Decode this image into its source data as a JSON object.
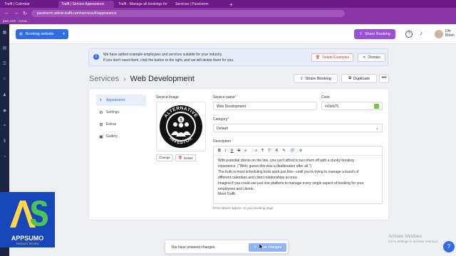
{
  "browser": {
    "tabs": [
      {
        "label": "Trafft | Calendar",
        "active": false
      },
      {
        "label": "Trafft | Service Appearance",
        "active": true
      },
      {
        "label": "Trafft - Manage all bookings for",
        "active": false
      },
      {
        "label": "Services | Passiverm",
        "active": false
      }
    ],
    "new_tab_glyph": "+",
    "url": "passiverm.admin.trafft.com/services/4/appearance",
    "bookmark_text": "pact.com - Actua..."
  },
  "header": {
    "business_button": "Booking website",
    "share_button": "Share Booking",
    "user_name_line1": "Dhr",
    "user_name_line2": "Boleh",
    "icons": [
      "help-icon",
      "bell-icon",
      "settings-icon"
    ]
  },
  "banner": {
    "line1": "We have added example employees and services suitable for your industry.",
    "line2": "If you don't need them, click the button to the right, and we will delete them for you.",
    "delete_examples": "Delete Examples",
    "dismiss": "Dismiss"
  },
  "breadcrumb": {
    "parent": "Services",
    "separator": "›",
    "current": "Web Development"
  },
  "page_actions": {
    "share": "Share Booking",
    "duplicate": "Duplicate",
    "more": "•••"
  },
  "subnav": [
    {
      "label": "Appearance",
      "icon": "palette-icon",
      "glyph": "◐",
      "active": true
    },
    {
      "label": "Settings",
      "icon": "gear-icon",
      "glyph": "⚙",
      "active": false
    },
    {
      "label": "Extras",
      "icon": "extras-icon",
      "glyph": "⊞",
      "active": false
    },
    {
      "label": "Gallery",
      "icon": "gallery-icon",
      "glyph": "▣",
      "active": false
    }
  ],
  "form": {
    "service_image_label": "Service Image",
    "logo_top_text": "ALTERNATIVE",
    "logo_bottom_text": "INVESTOR",
    "change_button": "Change",
    "delete_button": "Delete",
    "service_name_label": "Service name",
    "required_mark": "*",
    "service_name_value": "Web Development",
    "color_label": "Color",
    "color_value": "#c0eb75",
    "swatch_color": "#7bc53f",
    "category_label": "Category",
    "category_value": "Default",
    "description_label": "Description",
    "toolbar": [
      "B",
      "I",
      "U",
      "S",
      "≡",
      "⋮≡",
      "¶",
      "Tᵗ",
      "A",
      "✎",
      "🔗",
      "⊘"
    ],
    "description_lines": [
      "With potential clients on the line, you can't afford to turn them off with a clunky booking",
      "experience. (\"Web; guess this was a dealbreaker after all.\")",
      "The truth is most scheduling tools work just fine—until you're trying to manage a bunch of",
      "different calendars and client relationships at once.",
      "Imagine if you could use just one platform to manage every single aspect of booking for your",
      "employees and clients.",
      "Meet Trafft."
    ],
    "description_hint": "Descriptions appear on your booking page."
  },
  "unsaved": {
    "message": "You have unsaved changes.",
    "save_button": "Save changes"
  },
  "watermark": {
    "brand": "APPSUMO",
    "brand_sub": "PRODUCT REVIEW"
  },
  "os_notice": {
    "line1": "Activate Windows",
    "line2": "Go to Settings to activate Windows."
  }
}
